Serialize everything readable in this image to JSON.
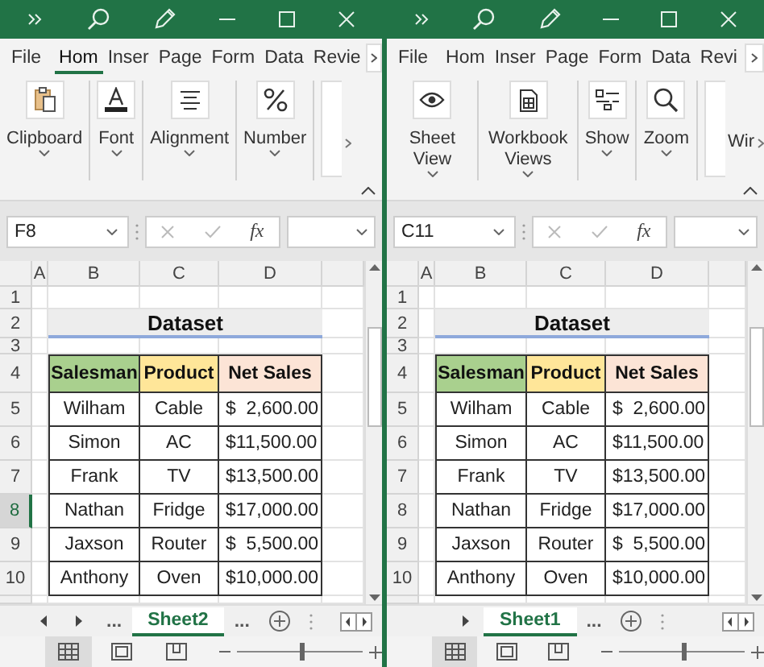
{
  "windows": [
    {
      "ribbon_tabs": [
        {
          "label": "File",
          "selected": false
        },
        {
          "label": "Hom",
          "selected": true
        },
        {
          "label": "Inser",
          "selected": false
        },
        {
          "label": "Page",
          "selected": false
        },
        {
          "label": "Form",
          "selected": false
        },
        {
          "label": "Data",
          "selected": false
        },
        {
          "label": "Revie",
          "selected": false
        }
      ],
      "ribbon_groups": [
        {
          "label": "Clipboard"
        },
        {
          "label": "Font"
        },
        {
          "label": "Alignment"
        },
        {
          "label": "Number"
        }
      ],
      "formula_bar": {
        "name_box": "F8",
        "function_label": "fx"
      },
      "column_headers": [
        "A",
        "B",
        "C",
        "D"
      ],
      "row_headers": [
        {
          "label": "1",
          "selected": false
        },
        {
          "label": "2",
          "selected": false
        },
        {
          "label": "3",
          "selected": false
        },
        {
          "label": "4",
          "selected": false
        },
        {
          "label": "5",
          "selected": false
        },
        {
          "label": "6",
          "selected": false
        },
        {
          "label": "7",
          "selected": false
        },
        {
          "label": "8",
          "selected": true
        },
        {
          "label": "9",
          "selected": false
        },
        {
          "label": "10",
          "selected": false
        }
      ],
      "table": {
        "title": "Dataset",
        "columns": [
          {
            "label": "Salesman",
            "color": "#a9d08e"
          },
          {
            "label": "Product",
            "color": "#ffe699"
          },
          {
            "label": "Net Sales",
            "color": "#fce4d6"
          }
        ],
        "rows": [
          [
            "Wilham",
            "Cable",
            "$  2,600.00"
          ],
          [
            "Simon",
            "AC",
            "$11,500.00"
          ],
          [
            "Frank",
            "TV",
            "$13,500.00"
          ],
          [
            "Nathan",
            "Fridge",
            "$17,000.00"
          ],
          [
            "Jaxson",
            "Router",
            "$  5,500.00"
          ],
          [
            "Anthony",
            "Oven",
            "$10,000.00"
          ]
        ]
      },
      "sheet_bar": {
        "arrows": [
          {
            "kind": "prev"
          },
          {
            "kind": "next"
          }
        ],
        "ellipsis_before": "...",
        "tabs": [
          {
            "label": "Sheet2",
            "selected": true
          }
        ],
        "ellipsis_after": "..."
      },
      "status_bar": {
        "views": [
          {
            "kind": "normal",
            "selected": true
          },
          {
            "kind": "page_layout",
            "selected": false
          },
          {
            "kind": "page_break",
            "selected": false
          }
        ],
        "zoom": {
          "level": 0.51
        }
      }
    },
    {
      "ribbon_tabs": [
        {
          "label": "File",
          "selected": false
        },
        {
          "label": "Hom",
          "selected": false
        },
        {
          "label": "Inser",
          "selected": false
        },
        {
          "label": "Page",
          "selected": false
        },
        {
          "label": "Form",
          "selected": false
        },
        {
          "label": "Data",
          "selected": false
        },
        {
          "label": "Revi",
          "selected": false
        }
      ],
      "ribbon_groups": [
        {
          "label": "Sheet View"
        },
        {
          "label": "Workbook Views"
        },
        {
          "label": "Show"
        },
        {
          "label": "Zoom"
        }
      ],
      "ribbon_partial_label": "Wir",
      "formula_bar": {
        "name_box": "C11",
        "function_label": "fx"
      },
      "column_headers": [
        "A",
        "B",
        "C",
        "D"
      ],
      "row_headers": [
        {
          "label": "1",
          "selected": false
        },
        {
          "label": "2",
          "selected": false
        },
        {
          "label": "3",
          "selected": false
        },
        {
          "label": "4",
          "selected": false
        },
        {
          "label": "5",
          "selected": false
        },
        {
          "label": "6",
          "selected": false
        },
        {
          "label": "7",
          "selected": false
        },
        {
          "label": "8",
          "selected": false
        },
        {
          "label": "9",
          "selected": false
        },
        {
          "label": "10",
          "selected": false
        }
      ],
      "table": {
        "title": "Dataset",
        "columns": [
          {
            "label": "Salesman",
            "color": "#a9d08e"
          },
          {
            "label": "Product",
            "color": "#ffe699"
          },
          {
            "label": "Net Sales",
            "color": "#fce4d6"
          }
        ],
        "rows": [
          [
            "Wilham",
            "Cable",
            "$  2,600.00"
          ],
          [
            "Simon",
            "AC",
            "$11,500.00"
          ],
          [
            "Frank",
            "TV",
            "$13,500.00"
          ],
          [
            "Nathan",
            "Fridge",
            "$17,000.00"
          ],
          [
            "Jaxson",
            "Router",
            "$  5,500.00"
          ],
          [
            "Anthony",
            "Oven",
            "$10,000.00"
          ]
        ]
      },
      "sheet_bar": {
        "arrows": [
          {
            "kind": "next"
          }
        ],
        "tabs": [
          {
            "label": "Sheet1",
            "selected": true
          }
        ],
        "ellipsis_after": "..."
      },
      "status_bar": {
        "views": [
          {
            "kind": "normal",
            "selected": true
          },
          {
            "kind": "page_layout",
            "selected": false
          },
          {
            "kind": "page_break",
            "selected": false
          }
        ],
        "zoom": {
          "level": 0.51
        }
      }
    }
  ]
}
